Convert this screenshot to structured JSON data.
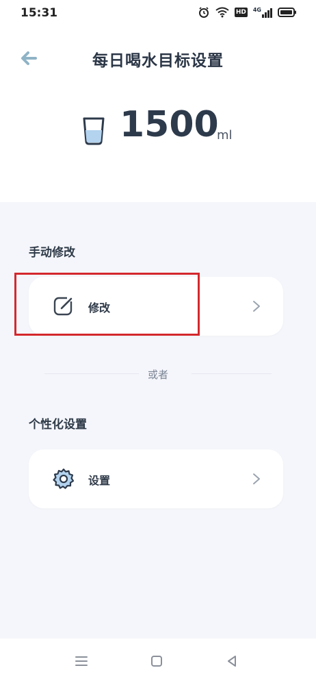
{
  "status_bar": {
    "time": "15:31",
    "hd_label": "HD",
    "network_label": "4G"
  },
  "header": {
    "title": "每日喝水目标设置"
  },
  "goal": {
    "value": "1500",
    "unit": "ml"
  },
  "manual_section": {
    "title": "手动修改",
    "item_label": "修改"
  },
  "separator": {
    "text": "或者"
  },
  "personalize_section": {
    "title": "个性化设置",
    "item_label": "设置"
  },
  "colors": {
    "accent_water": "#b3d3ef",
    "panel_bg": "#f5f6fb",
    "highlight": "#d4282c"
  }
}
